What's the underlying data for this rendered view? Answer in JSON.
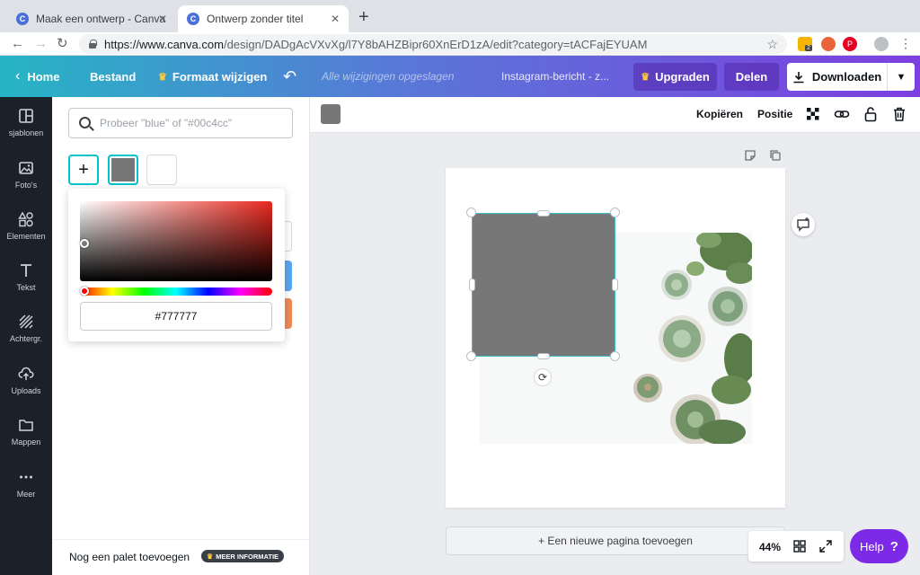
{
  "browser": {
    "tabs": [
      {
        "title": "Maak een ontwerp - Canva",
        "favicon": "C"
      },
      {
        "title": "Ontwerp zonder titel",
        "favicon": "C"
      }
    ],
    "url_host": "https://www.canva.com",
    "url_path": "/design/DADgAcVXvXg/l7Y8bAHZBipr60XnErD1zA/edit?category=tACFajEYUAM",
    "extension_badge": "2"
  },
  "header": {
    "home": "Home",
    "file": "Bestand",
    "resize": "Formaat wijzigen",
    "saved_status": "Alle wijzigingen opgeslagen",
    "doc_title": "Instagram-bericht - z...",
    "upgrade": "Upgraden",
    "share": "Delen",
    "download": "Downloaden"
  },
  "sidebar": {
    "items": [
      {
        "label": "sjablonen",
        "icon": "templates-icon"
      },
      {
        "label": "Foto's",
        "icon": "photos-icon"
      },
      {
        "label": "Elementen",
        "icon": "elements-icon"
      },
      {
        "label": "Tekst",
        "icon": "text-icon"
      },
      {
        "label": "Achtergr.",
        "icon": "background-icon"
      },
      {
        "label": "Uploads",
        "icon": "upload-icon"
      },
      {
        "label": "Mappen",
        "icon": "folder-icon"
      },
      {
        "label": "Meer",
        "icon": "more-icon"
      }
    ]
  },
  "panel": {
    "search_placeholder": "Probeer \"blue\" of \"#00c4cc\"",
    "add_symbol": "+",
    "hex_value": "#777777",
    "add_palette": "Nog een palet toevoegen",
    "more_info": "MEER INFORMATIE"
  },
  "toolbar": {
    "copy": "Kopiëren",
    "position": "Positie"
  },
  "canvas": {
    "add_page": "+ Een nieuwe pagina toevoegen",
    "zoom": "44%"
  },
  "help": {
    "label": "Help",
    "symbol": "?"
  },
  "colors": {
    "selected_fill": "#777777",
    "selection_outline": "#3bc3cc",
    "help_button": "#7d2ae8",
    "upgrade_crown": "#ffc93c"
  }
}
